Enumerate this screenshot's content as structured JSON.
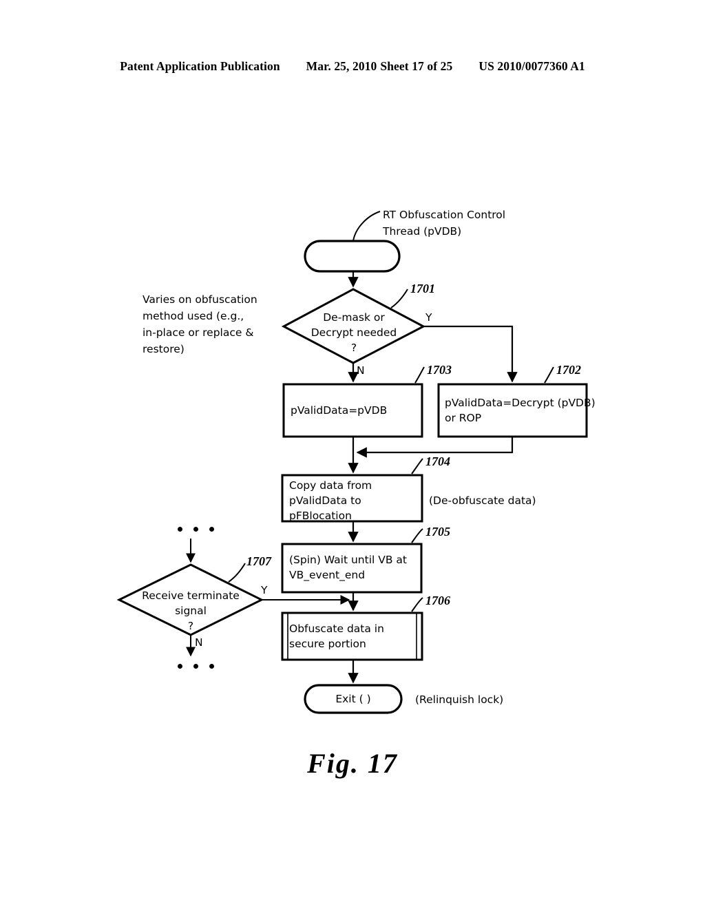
{
  "header": {
    "publication": "Patent Application Publication",
    "date": "Mar. 25, 2010",
    "sheet": "Sheet 17 of 25",
    "pub_number": "US 2010/0077360 A1"
  },
  "figure": {
    "caption": "Fig. 17",
    "title_annotation": "RT Obfuscation Control\nThread (pVDB)",
    "nodes": {
      "start": {
        "label": "",
        "ref": ""
      },
      "decision_1701": {
        "ref": "1701",
        "label": "De-mask or\nDecrypt needed\n?",
        "yes_label": "Y",
        "no_label": "N"
      },
      "process_1703": {
        "ref": "1703",
        "label": "pValidData=pVDB"
      },
      "process_1702": {
        "ref": "1702",
        "label": "pValidData=Decrypt (pVDB)\nor ROP"
      },
      "process_1704": {
        "ref": "1704",
        "label": "Copy data from\npValidData to\npFBlocation"
      },
      "process_1705": {
        "ref": "1705",
        "label": "(Spin) Wait until VB at\nVB_event_end"
      },
      "process_1706": {
        "ref": "1706",
        "label": "Obfuscate data in\nsecure portion"
      },
      "decision_1707": {
        "ref": "1707",
        "label": "Receive terminate\nsignal\n?",
        "yes_label": "Y",
        "no_label": "N"
      },
      "exit": {
        "label": "Exit ( )"
      }
    },
    "annotations": {
      "varies": "Varies on obfuscation\nmethod used (e.g.,\nin-place or replace &\nrestore)",
      "deobfuscate": "(De-obfuscate data)",
      "relinquish": "(Relinquish lock)"
    },
    "colors": {
      "ink": "#000000",
      "background": "#ffffff"
    }
  }
}
